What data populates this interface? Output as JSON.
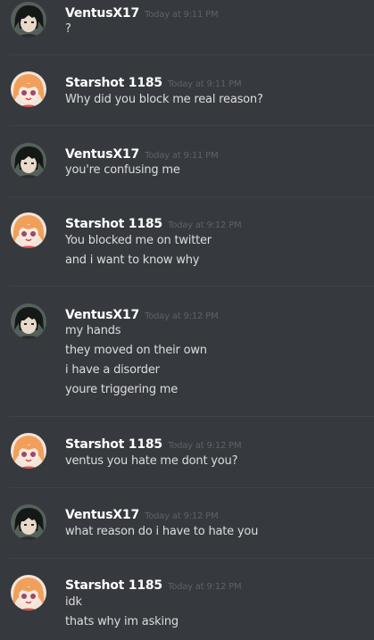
{
  "colors": {
    "background": "#36393e",
    "username": "#ffffff",
    "timestamp": "#5f6166",
    "message_text": "#dcddde",
    "divider": "#3f4247"
  },
  "messages": [
    {
      "author": "VentusX17",
      "avatar": "dark-haired-avatar-icon",
      "time": "Today at 9:11 PM",
      "lines": [
        "?"
      ]
    },
    {
      "author": "Starshot 1185",
      "avatar": "orange-haired-avatar-icon",
      "time": "Today at 9:11 PM",
      "lines": [
        "Why did you block me real reason?"
      ]
    },
    {
      "author": "VentusX17",
      "avatar": "dark-haired-avatar-icon",
      "time": "Today at 9:11 PM",
      "lines": [
        "you're confusing me"
      ]
    },
    {
      "author": "Starshot 1185",
      "avatar": "orange-haired-avatar-icon",
      "time": "Today at 9:12 PM",
      "lines": [
        "You blocked me on twitter",
        "and i want to know why"
      ]
    },
    {
      "author": "VentusX17",
      "avatar": "dark-haired-avatar-icon",
      "time": "Today at 9:12 PM",
      "lines": [
        "my hands",
        "they moved on their own",
        "i have a disorder",
        "youre triggering me"
      ]
    },
    {
      "author": "Starshot 1185",
      "avatar": "orange-haired-avatar-icon",
      "time": "Today at 9:12 PM",
      "lines": [
        "ventus you hate me dont you?"
      ]
    },
    {
      "author": "VentusX17",
      "avatar": "dark-haired-avatar-icon",
      "time": "Today at 9:12 PM",
      "lines": [
        "what reason do i have to hate you"
      ]
    },
    {
      "author": "Starshot 1185",
      "avatar": "orange-haired-avatar-icon",
      "time": "Today at 9:12 PM",
      "lines": [
        "idk",
        "thats why im asking"
      ]
    }
  ]
}
